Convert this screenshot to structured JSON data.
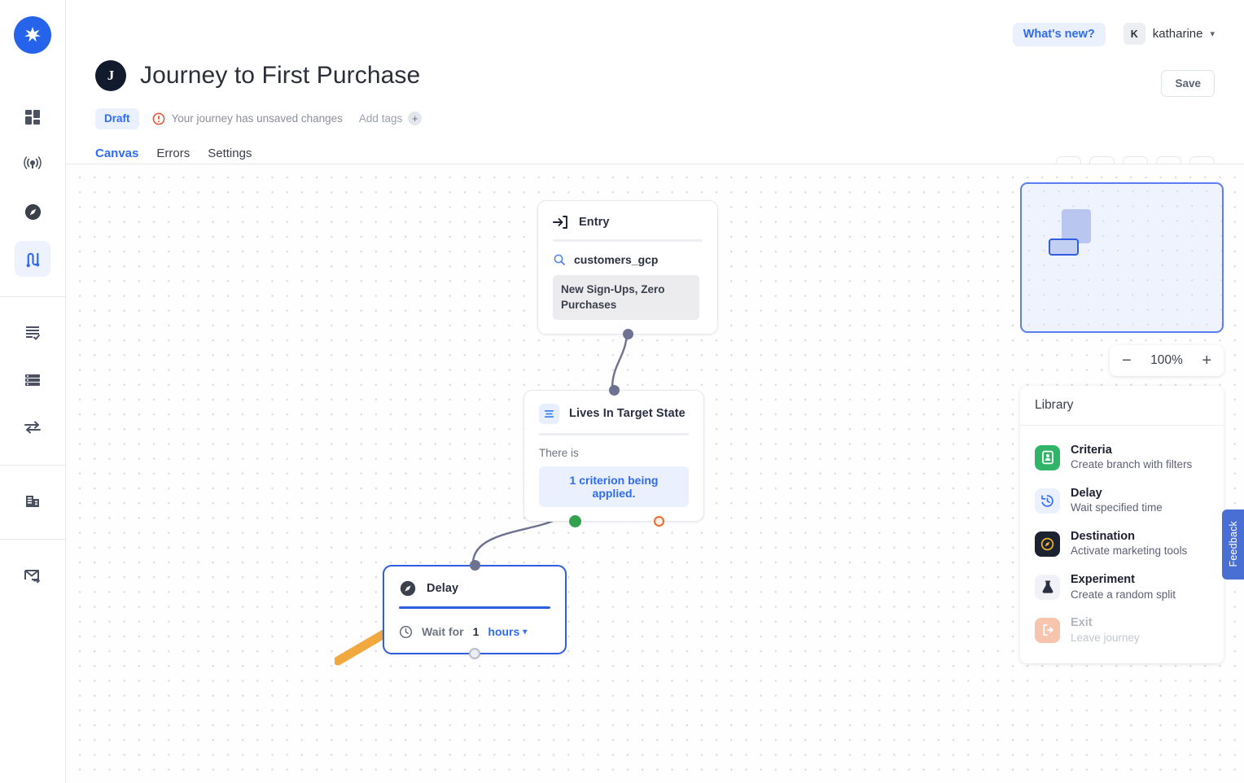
{
  "brand": {
    "logo_icon": "sparkle-logo",
    "accent": "#2f6bf5"
  },
  "rail": {
    "items": [
      {
        "name": "dashboard",
        "icon": "dashboard-grid-icon",
        "active": false
      },
      {
        "name": "broadcast",
        "icon": "broadcast-signal-icon",
        "active": false
      },
      {
        "name": "destinations",
        "icon": "compass-icon",
        "active": false
      },
      {
        "name": "journeys",
        "icon": "journey-path-icon",
        "active": true
      },
      {
        "name": "audiences",
        "icon": "list-check-icon",
        "active": false
      },
      {
        "name": "data-sources",
        "icon": "database-icon",
        "active": false
      },
      {
        "name": "syncs",
        "icon": "transfer-arrows-icon",
        "active": false
      },
      {
        "name": "models",
        "icon": "building-columns-icon",
        "active": false
      },
      {
        "name": "campaigns",
        "icon": "mail-send-icon",
        "active": false
      }
    ]
  },
  "topbar": {
    "whats_new_label": "What's new?",
    "user_initial": "K",
    "username": "katharine",
    "caret_icon": "chevron-down-icon"
  },
  "header": {
    "title_initial": "J",
    "title": "Journey to First Purchase",
    "save_label": "Save",
    "status_badge": "Draft",
    "unsaved_message": "Your journey has unsaved changes",
    "unsaved_icon": "alert-circle-icon",
    "add_tags_label": "Add tags",
    "add_tags_icon": "plus-icon",
    "tabs": [
      {
        "label": "Canvas",
        "active": true
      },
      {
        "label": "Errors",
        "active": false
      },
      {
        "label": "Settings",
        "active": false
      }
    ],
    "tools": [
      {
        "name": "analytics",
        "icon": "bar-chart-icon"
      },
      {
        "name": "warnings",
        "icon": "warning-triangle-icon"
      },
      {
        "name": "schedule",
        "icon": "calendar-icon"
      },
      {
        "name": "duplicate",
        "icon": "copy-plus-icon"
      },
      {
        "name": "collapse",
        "icon": "collapse-vertical-icon"
      }
    ]
  },
  "canvas": {
    "nodes": {
      "entry": {
        "title": "Entry",
        "icon": "enter-arrow-icon",
        "source_icon": "search-icon",
        "source": "customers_gcp",
        "segment": "New Sign-Ups, Zero Purchases"
      },
      "criteria": {
        "title": "Lives In Target State",
        "icon": "filter-lines-icon",
        "prefix": "There is",
        "criterion_text": "1 criterion being applied."
      },
      "delay": {
        "title": "Delay",
        "icon": "compass-icon",
        "clock_icon": "clock-icon",
        "wait_label": "Wait for",
        "wait_value": "1",
        "wait_unit": "hours",
        "unit_caret_icon": "chevron-down-icon",
        "selected": true
      }
    },
    "annotation_arrow": {
      "icon": "pointer-arrow-icon",
      "color": "#f0a93e"
    }
  },
  "minimap": {
    "name": "canvas-minimap"
  },
  "zoom": {
    "minus_label": "−",
    "value": "100%",
    "plus_label": "+"
  },
  "library": {
    "heading": "Library",
    "items": [
      {
        "title": "Criteria",
        "subtitle": "Create branch with filters",
        "icon": "criteria-card-icon",
        "bg": "#32b36a",
        "fg": "#ffffff",
        "disabled": false
      },
      {
        "title": "Delay",
        "subtitle": "Wait specified time",
        "icon": "clock-rewind-icon",
        "bg": "#eaf0fe",
        "fg": "#2f6bf5",
        "disabled": false
      },
      {
        "title": "Destination",
        "subtitle": "Activate marketing tools",
        "icon": "compass-icon",
        "bg": "#1b2230",
        "fg": "#f0b429",
        "disabled": false
      },
      {
        "title": "Experiment",
        "subtitle": "Create a random split",
        "icon": "flask-icon",
        "bg": "#f0f2f7",
        "fg": "#2b3040",
        "disabled": false
      },
      {
        "title": "Exit",
        "subtitle": "Leave journey",
        "icon": "exit-arrow-icon",
        "bg": "#f7c4ae",
        "fg": "#ffffff",
        "disabled": true
      }
    ]
  },
  "feedback": {
    "label": "Feedback"
  }
}
